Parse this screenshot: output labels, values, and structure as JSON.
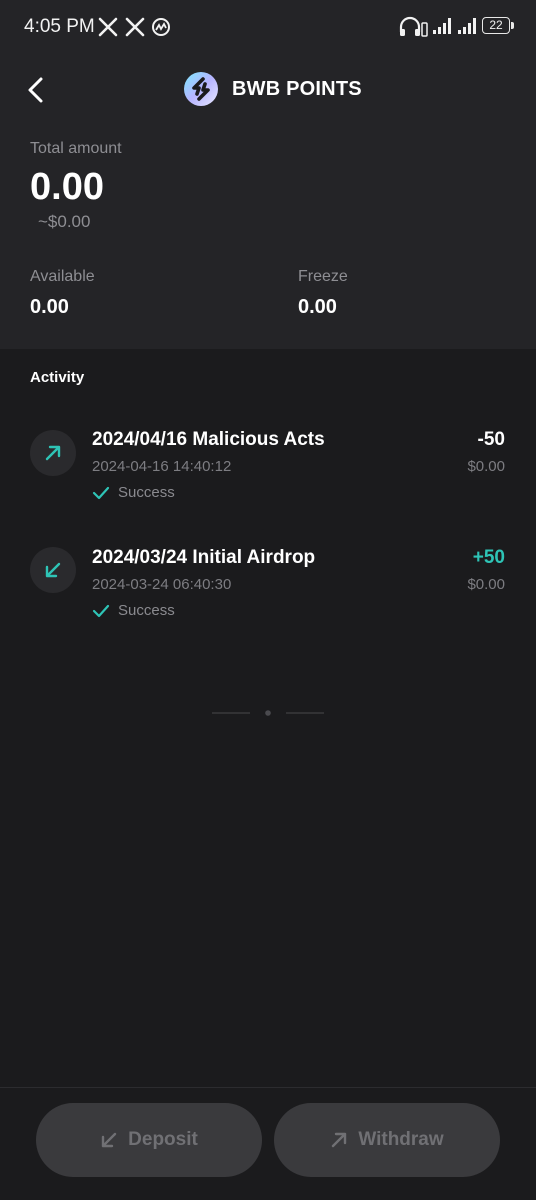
{
  "status_bar": {
    "time": "4:05 PM",
    "battery": "22",
    "notification_icons": [
      "x-icon",
      "x-icon",
      "coinmarketcap-icon"
    ],
    "system_icons": [
      "headphones-icon",
      "signal-icon",
      "signal-icon",
      "battery-icon"
    ]
  },
  "header": {
    "title": "BWB POINTS",
    "back_icon": "chevron-left-icon",
    "logo_icon": "bwb-logo-icon"
  },
  "balance": {
    "total_label": "Total amount",
    "total_value": "0.00",
    "total_usd": "~$0.00",
    "available_label": "Available",
    "available_value": "0.00",
    "freeze_label": "Freeze",
    "freeze_value": "0.00"
  },
  "activity": {
    "title": "Activity",
    "items": [
      {
        "title": "2024/04/16 Malicious Acts",
        "datetime": "2024-04-16 14:40:12",
        "status": "Success",
        "amount": "-50",
        "fiat": "$0.00",
        "direction_icon": "arrow-up-right-icon"
      },
      {
        "title": "2024/03/24 Initial Airdrop",
        "datetime": "2024-03-24 06:40:30",
        "status": "Success",
        "amount": "+50",
        "fiat": "$0.00",
        "direction_icon": "arrow-down-left-icon"
      }
    ]
  },
  "actions": {
    "deposit_label": "Deposit",
    "withdraw_label": "Withdraw"
  },
  "colors": {
    "accent_teal": "#2ec4b6",
    "top_background": "#242427",
    "page_background": "#1b1b1d",
    "button_background": "#3a3a3d",
    "muted_text": "#8e8e93"
  }
}
